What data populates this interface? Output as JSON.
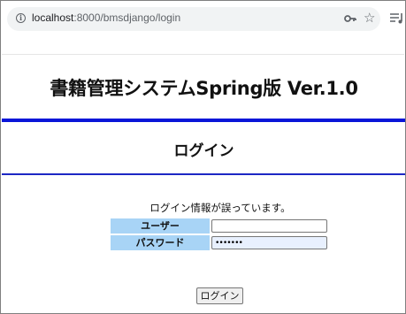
{
  "browser": {
    "url_host": "localhost",
    "url_path": ":8000/bmsdjango/login",
    "info_icon_glyph": "i",
    "icons": [
      "info-icon",
      "key-icon",
      "star-icon",
      "reading-list-icon"
    ]
  },
  "page": {
    "app_title": "書籍管理システムSpring版 Ver.1.0",
    "heading": "ログイン",
    "error_message": "ログイン情報が誤っています。"
  },
  "form": {
    "user_label": "ユーザー",
    "user_value": "",
    "password_label": "パスワード",
    "password_value": "•••••••",
    "submit_label": "ログイン"
  },
  "colors": {
    "accent_rule": "#0a16d8",
    "label_background": "#a8d4f6",
    "autofill_background": "#e8f0fe"
  }
}
